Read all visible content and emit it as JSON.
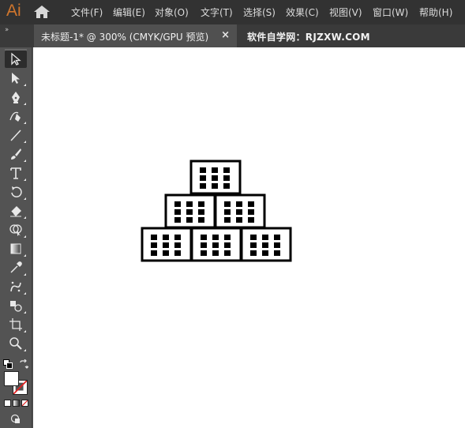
{
  "app": {
    "logo": "Ai",
    "home_icon": "home-icon"
  },
  "menu": [
    {
      "label": "文件(F)"
    },
    {
      "label": "编辑(E)"
    },
    {
      "label": "对象(O)"
    },
    {
      "label": "文字(T)"
    },
    {
      "label": "选择(S)"
    },
    {
      "label": "效果(C)"
    },
    {
      "label": "视图(V)"
    },
    {
      "label": "窗口(W)"
    },
    {
      "label": "帮助(H)"
    }
  ],
  "tabs": {
    "collapse_label": "››",
    "active_title": "未标题-1* @ 300% (CMYK/GPU 预览)",
    "close_label": "×",
    "site_label": "软件自学网：RJZXW.COM"
  },
  "toolbar": {
    "tools": [
      {
        "name": "selection-tool",
        "icon": "selection-arrow-icon",
        "selected": true
      },
      {
        "name": "direct-selection-tool",
        "icon": "direct-selection-arrow-icon"
      },
      {
        "name": "pen-tool",
        "icon": "pen-icon"
      },
      {
        "name": "curvature-tool",
        "icon": "curvature-pen-icon"
      },
      {
        "name": "line-tool",
        "icon": "line-segment-icon"
      },
      {
        "name": "paintbrush-tool",
        "icon": "paintbrush-icon"
      },
      {
        "name": "type-tool",
        "icon": "type-icon",
        "glyph": "T"
      },
      {
        "name": "rotate-tool",
        "icon": "rotate-icon"
      },
      {
        "name": "eraser-tool",
        "icon": "eraser-icon"
      },
      {
        "name": "shape-builder-tool",
        "icon": "shape-builder-icon"
      },
      {
        "name": "gradient-tool",
        "icon": "gradient-icon"
      },
      {
        "name": "eyedropper-tool",
        "icon": "eyedropper-icon"
      },
      {
        "name": "symbol-sprayer-tool",
        "icon": "symbol-sprayer-icon"
      },
      {
        "name": "blend-tool",
        "icon": "blend-icon"
      },
      {
        "name": "artboard-tool",
        "icon": "artboard-icon"
      },
      {
        "name": "zoom-tool",
        "icon": "zoom-icon"
      }
    ],
    "fill_color": "#ffffff",
    "stroke_color": "none"
  },
  "colors": {
    "menubar_bg": "#323232",
    "panel_bg": "#535353",
    "accent_logo": "#d0762d",
    "canvas_bg": "#ffffff",
    "artwork_stroke": "#000000"
  }
}
